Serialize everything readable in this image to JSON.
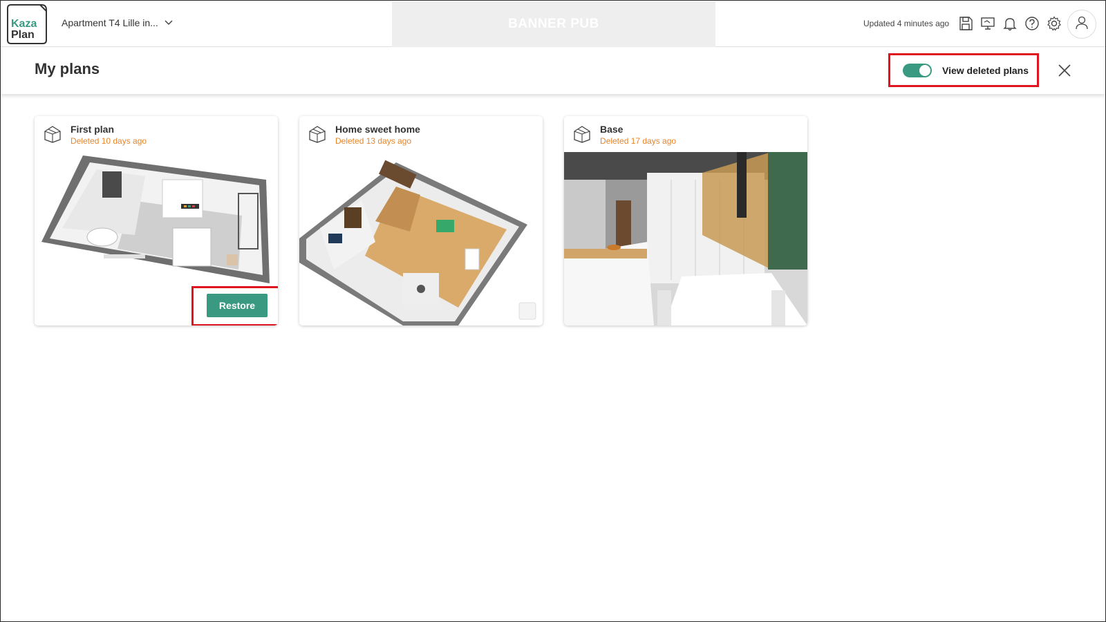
{
  "logo": {
    "line1": "Kaza",
    "line2": "Plan"
  },
  "topbar": {
    "project_name": "Apartment T4 Lille in...",
    "banner_text": "BANNER PUB",
    "updated_text": "Updated 4 minutes ago",
    "icons": [
      "save-icon",
      "presentation-icon",
      "bell-icon",
      "help-icon",
      "gear-icon",
      "user-icon"
    ]
  },
  "header": {
    "title": "My plans",
    "toggle_label": "View deleted plans",
    "toggle_on": true
  },
  "plans": [
    {
      "title": "First plan",
      "status": "Deleted 10 days ago",
      "action": "Restore"
    },
    {
      "title": "Home sweet home",
      "status": "Deleted 13 days ago"
    },
    {
      "title": "Base",
      "status": "Deleted 17 days ago"
    }
  ],
  "colors": {
    "accent": "#3a9a81",
    "status": "#e8852a",
    "highlight": "#e0141e"
  }
}
